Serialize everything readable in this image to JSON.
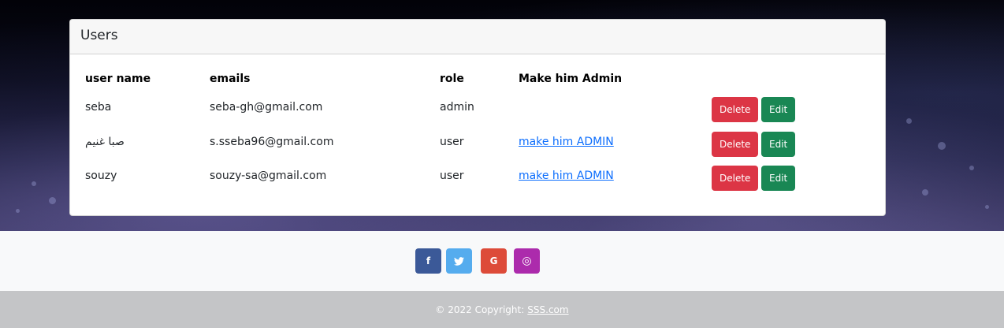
{
  "card": {
    "title": "Users"
  },
  "table": {
    "headers": [
      "user name",
      "emails",
      "role",
      "Make him Admin"
    ],
    "rows": [
      {
        "name": "seba",
        "email": "seba-gh@gmail.com",
        "role": "admin",
        "admin_link": ""
      },
      {
        "name": "صبا غنيم",
        "email": "s.sseba96@gmail.com",
        "role": "user",
        "admin_link": "make him ADMIN"
      },
      {
        "name": "souzy",
        "email": "souzy-sa@gmail.com",
        "role": "user",
        "admin_link": "make him ADMIN"
      }
    ],
    "delete_label": "Delete",
    "edit_label": "Edit"
  },
  "social": [
    {
      "icon": "facebook-icon",
      "glyph": "f",
      "color": "#3b5998"
    },
    {
      "icon": "twitter-icon",
      "glyph": "🐦",
      "color": "#55acee"
    },
    {
      "icon": "google-icon",
      "glyph": "G",
      "color": "#dd4b39"
    },
    {
      "icon": "instagram-icon",
      "glyph": "◎",
      "color": "#ac2bac"
    }
  ],
  "footer": {
    "copyright": "© 2022 Copyright:",
    "link": "SSS.com"
  }
}
